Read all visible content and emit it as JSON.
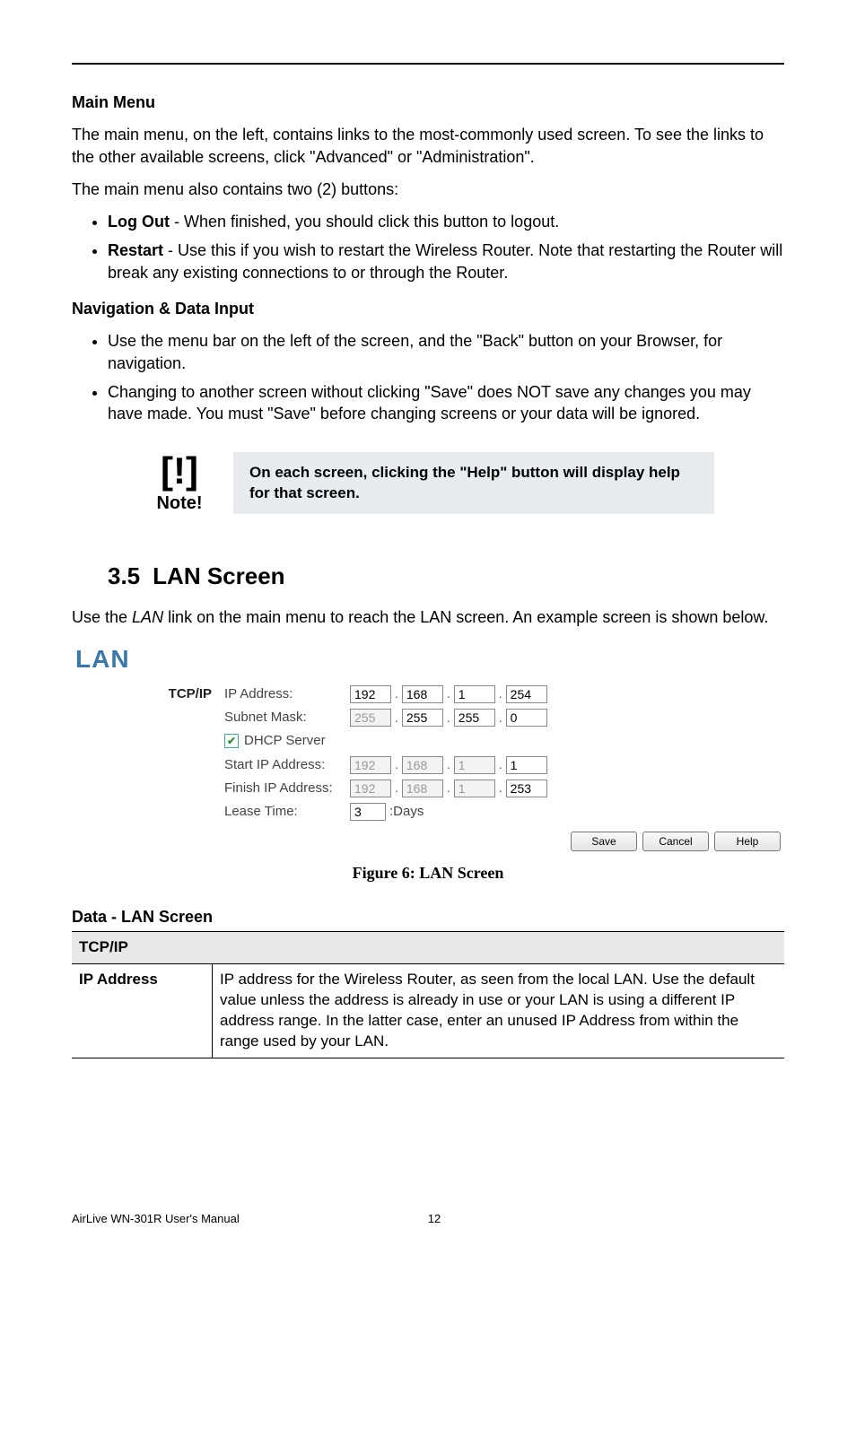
{
  "headings": {
    "main_menu": "Main Menu",
    "nav_input": "Navigation & Data Input",
    "section_num": "3.5",
    "section_title": "LAN Screen",
    "data_lan": "Data - LAN Screen"
  },
  "paras": {
    "main_menu_intro": "The main menu, on the left, contains links to the most-commonly used screen. To see the links to the other available screens, click \"Advanced\" or \"Administration\".",
    "main_menu_buttons_intro": "The main menu also contains two (2) buttons:",
    "logout_label": "Log Out",
    "logout_text": " - When finished, you should click this button to logout.",
    "restart_label": "Restart",
    "restart_text": " - Use this if you wish to restart the Wireless Router. Note that restarting the Router will break any existing connections to or through the Router.",
    "nav_li1": "Use the menu bar on the left of the screen, and the \"Back\" button on your Browser, for navigation.",
    "nav_li2": "Changing to another screen without clicking \"Save\" does NOT save any changes you may have made. You must \"Save\" before changing screens or your data will be ignored.",
    "lan_intro_pre": "Use the ",
    "lan_intro_em": "LAN",
    "lan_intro_post": " link on the main menu to reach the LAN screen. An example screen is shown below."
  },
  "note": {
    "icon": "[!]",
    "label": "Note!",
    "text": "On each screen, clicking the \"Help\" button will display help for that screen."
  },
  "lan_screen": {
    "title": "LAN",
    "group": "TCP/IP",
    "rows": {
      "ip_label": "IP Address:",
      "subnet_label": "Subnet Mask:",
      "dhcp_label": "DHCP Server",
      "start_label": "Start IP Address:",
      "finish_label": "Finish IP Address:",
      "lease_label": "Lease Time:",
      "lease_unit": ":Days"
    },
    "values": {
      "ip": [
        "192",
        "168",
        "1",
        "254"
      ],
      "subnet": [
        "255",
        "255",
        "255",
        "0"
      ],
      "dhcp_checked": true,
      "start": [
        "192",
        "168",
        "1",
        "1"
      ],
      "finish": [
        "192",
        "168",
        "1",
        "253"
      ],
      "lease": "3"
    },
    "buttons": {
      "save": "Save",
      "cancel": "Cancel",
      "help": "Help"
    },
    "caption": "Figure 6: LAN Screen"
  },
  "data_table": {
    "section": "TCP/IP",
    "row1_key": "IP Address",
    "row1_desc": "IP address for the Wireless Router, as seen from the local LAN. Use the default value unless the address is already in use or your LAN is using a different IP address range. In the latter case, enter an unused IP Address from within the range used by your LAN."
  },
  "footer": {
    "title": "AirLive WN-301R User's Manual",
    "page": "12"
  }
}
